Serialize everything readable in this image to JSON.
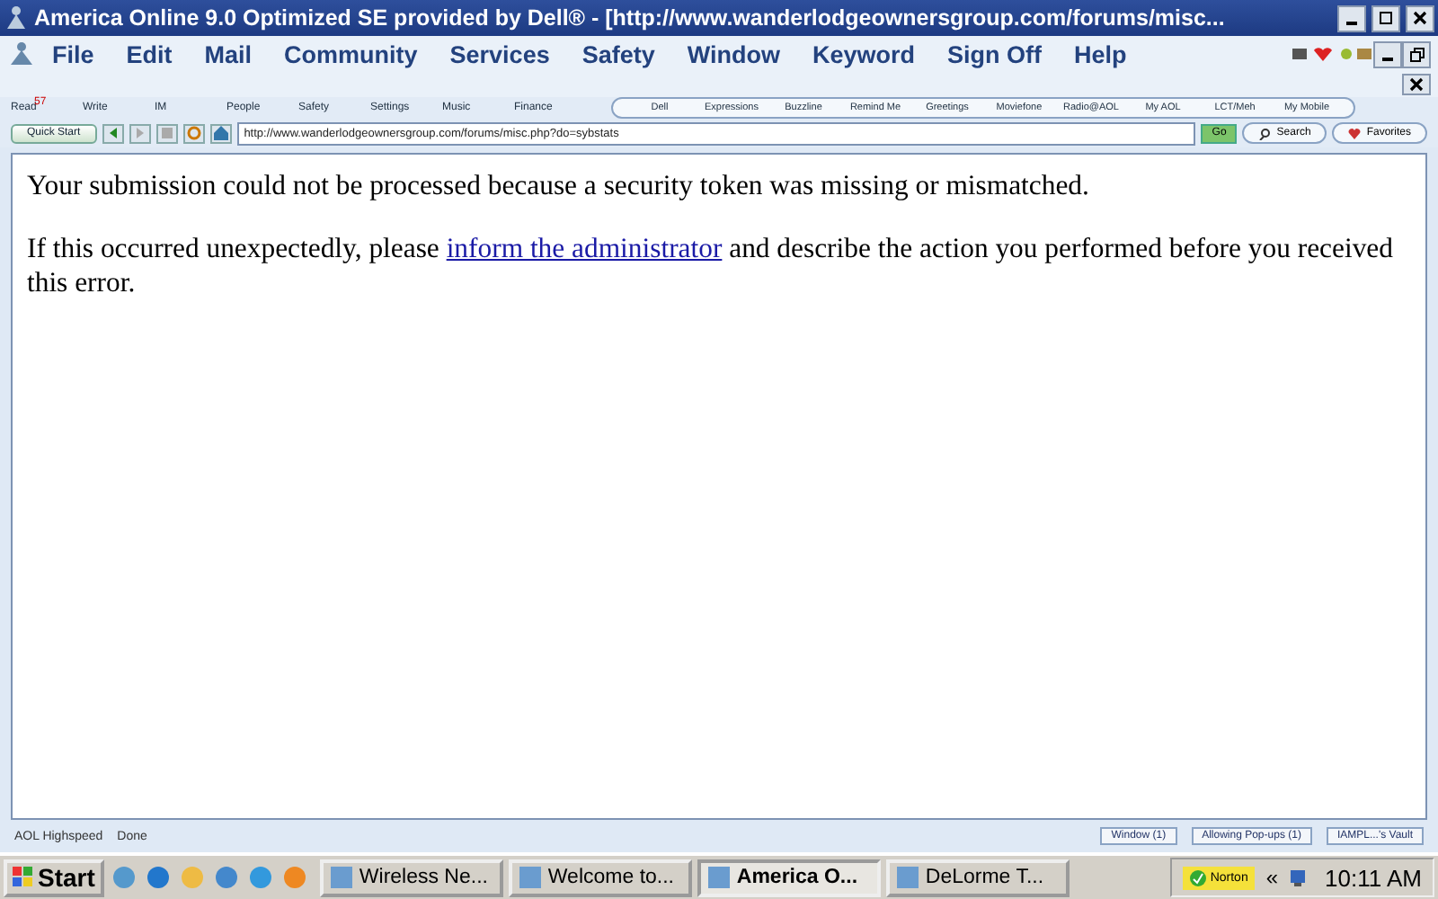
{
  "window": {
    "title": "America Online 9.0 Optimized SE provided by Dell® - [http://www.wanderlodgeownersgroup.com/forums/misc..."
  },
  "menu": [
    "File",
    "Edit",
    "Mail",
    "Community",
    "Services",
    "Safety",
    "Window",
    "Keyword",
    "Sign Off",
    "Help"
  ],
  "toolbar": [
    {
      "label": "Read",
      "badge": "57"
    },
    {
      "label": "Write"
    },
    {
      "label": "IM"
    },
    {
      "label": "People"
    },
    {
      "label": "Safety"
    },
    {
      "label": "Settings"
    },
    {
      "label": "Music"
    },
    {
      "label": "Finance"
    }
  ],
  "shortcuts": [
    "Dell",
    "Expressions",
    "Buzzline",
    "Remind Me",
    "Greetings",
    "Moviefone",
    "Radio@AOL",
    "My AOL",
    "LCT/Meh",
    "My Mobile"
  ],
  "address_bar": {
    "quick_start": "Quick Start",
    "url": "http://www.wanderlodgeownersgroup.com/forums/misc.php?do=sybstats",
    "go": "Go",
    "search": "Search",
    "favorites": "Favorites"
  },
  "content": {
    "message": "Your submission could not be processed because a security token was missing or mismatched.",
    "before_link": "If this occurred unexpectedly, please ",
    "link": "inform the administrator",
    "after_link": " and describe the action you performed before you received this error."
  },
  "status_bar": {
    "connection": "AOL Highspeed",
    "status": "Done",
    "panels": [
      "Window (1)",
      "Allowing Pop-ups (1)",
      "IAMPL...'s Vault"
    ]
  },
  "taskbar": {
    "start": "Start",
    "tasks": [
      {
        "label": "Wireless Ne...",
        "selected": false
      },
      {
        "label": "Welcome to...",
        "selected": false
      },
      {
        "label": "America O...",
        "selected": true
      },
      {
        "label": "DeLorme T...",
        "selected": false
      }
    ],
    "norton": "Norton",
    "tray_arrows": "«",
    "clock": "10:11 AM"
  }
}
